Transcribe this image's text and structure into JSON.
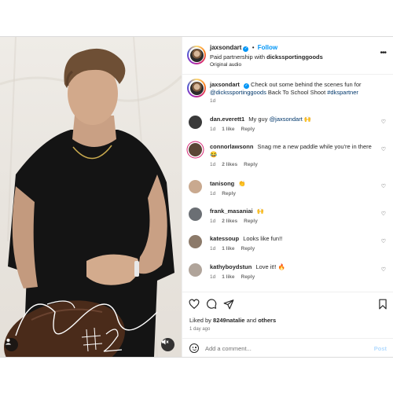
{
  "post": {
    "author": "jaxsondart",
    "follow_label": "Follow",
    "dot": "•",
    "partnership_prefix": "Paid partnership with",
    "partner": "dickssportinggoods",
    "audio": "Original audio",
    "more": "•••"
  },
  "caption": {
    "user": "jaxsondart",
    "text_prefix": "Check out some behind the scenes fun for",
    "mention": "@dickssportinggoods",
    "text_suffix": "Back To School Shoot",
    "hashtag": "#dkspartner",
    "time": "1d"
  },
  "comments": [
    {
      "user": "dan.everett1",
      "text": "My guy",
      "mention": "@jaxsondart",
      "emoji": "🙌",
      "time": "1d",
      "likes": "1 like",
      "reply": "Reply",
      "avatar_color": "#3a3a3a"
    },
    {
      "user": "connorlawsonn",
      "text": "Snag me a new paddle while you're in there",
      "mention": "",
      "emoji": "😂",
      "time": "1d",
      "likes": "2 likes",
      "reply": "Reply",
      "avatar_color": "#5a4635"
    },
    {
      "user": "tanisong",
      "text": "",
      "mention": "",
      "emoji": "👏",
      "time": "1d",
      "likes": "",
      "reply": "Reply",
      "avatar_color": "#c9a98f"
    },
    {
      "user": "frank_masaniai",
      "text": "",
      "mention": "",
      "emoji": "🙌",
      "time": "1d",
      "likes": "2 likes",
      "reply": "Reply",
      "avatar_color": "#6b6f74"
    },
    {
      "user": "katessoup",
      "text": "Looks like fun!!",
      "mention": "",
      "emoji": "",
      "time": "1d",
      "likes": "1 like",
      "reply": "Reply",
      "avatar_color": "#8c7a6a"
    },
    {
      "user": "kathyboydstun",
      "text": "Love it!!",
      "mention": "",
      "emoji": "🔥",
      "time": "1d",
      "likes": "1 like",
      "reply": "Reply",
      "avatar_color": "#b0a49a"
    }
  ],
  "footer": {
    "liked_prefix": "Liked by",
    "liked_user": "8249natalie",
    "liked_and": "and",
    "liked_others": "others",
    "ago": "1 day ago",
    "comment_placeholder": "Add a comment...",
    "post_label": "Post"
  },
  "icons": {
    "heart": "heart-icon",
    "comment": "comment-icon",
    "share": "share-icon",
    "save": "bookmark-icon",
    "user_tag": "user-tag-icon",
    "mute": "mute-icon",
    "emoji": "emoji-icon"
  },
  "colors": {
    "accent": "#0095f6",
    "post_disabled": "#b3dbff"
  }
}
